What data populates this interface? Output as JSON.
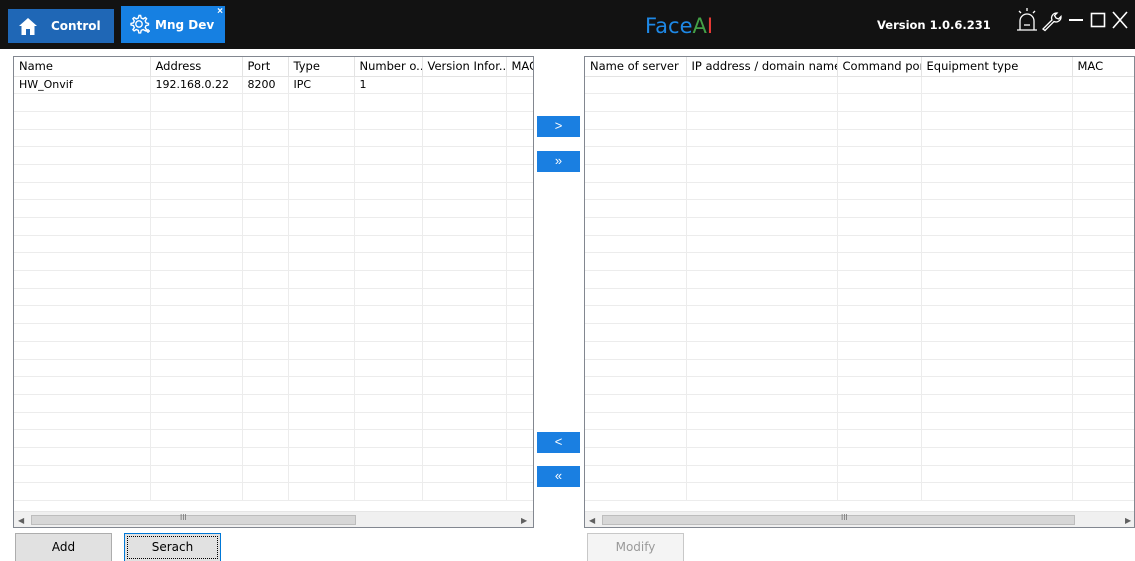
{
  "titlebar": {
    "tabs": [
      {
        "label": "Control",
        "icon": "home-icon"
      },
      {
        "label": "Mng Dev",
        "icon": "gear-icon",
        "close": "×"
      }
    ],
    "app_title_letters": [
      {
        "ch": "F",
        "color": "#1e88e5"
      },
      {
        "ch": "a",
        "color": "#1e88e5"
      },
      {
        "ch": "c",
        "color": "#1e88e5"
      },
      {
        "ch": "e",
        "color": "#1e88e5"
      },
      {
        "ch": "A",
        "color": "#43a047"
      },
      {
        "ch": "I",
        "color": "#e53935"
      }
    ],
    "version": "Version 1.0.6.231",
    "window_controls": [
      "alarm-icon",
      "wrench-icon",
      "minimize-icon",
      "maximize-icon",
      "close-icon"
    ]
  },
  "left_grid": {
    "columns": [
      "Name",
      "Address",
      "Port",
      "Type",
      "Number o...",
      "Version Infor...",
      "MAC"
    ],
    "rows": [
      [
        "HW_Onvif",
        "192.168.0.22",
        "8200",
        "IPC",
        "1",
        "",
        ""
      ]
    ],
    "empty_rows": 23,
    "scroll_grip": "III"
  },
  "right_grid": {
    "columns": [
      "Name of server",
      "IP address / domain name",
      "Command port",
      "Equipment type",
      "MAC"
    ],
    "rows": [],
    "empty_rows": 24,
    "scroll_grip": "III"
  },
  "transfer": {
    "move_one": ">",
    "move_all": "»",
    "back_one": "<",
    "back_all": "«"
  },
  "buttons": {
    "add": "Add",
    "search": "Serach",
    "modify": "Modify"
  },
  "colors": {
    "titlebar": "#121212",
    "tab_control": "#1f67b6",
    "tab_active": "#1680e2",
    "transfer_button": "#1a7fe1"
  }
}
